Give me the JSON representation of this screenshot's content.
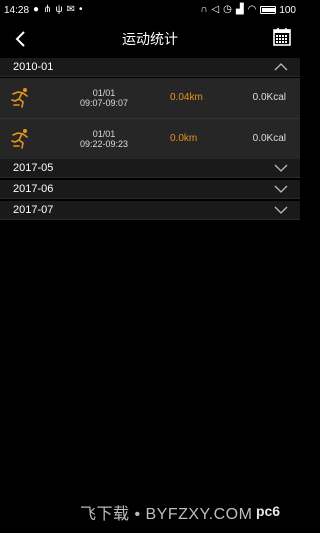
{
  "status_bar": {
    "time": "14:28",
    "battery": "100",
    "battery_level": 1.0
  },
  "header": {
    "title": "运动统计"
  },
  "months": [
    {
      "label": "2010-01",
      "expanded": true
    },
    {
      "label": "2017-05",
      "expanded": false
    },
    {
      "label": "2017-06",
      "expanded": false
    },
    {
      "label": "2017-07",
      "expanded": false
    }
  ],
  "records": [
    {
      "date": "01/01",
      "time_range": "09:07-09:07",
      "distance": "0.04km",
      "calories": "0.0Kcal",
      "icon": "runner-icon"
    },
    {
      "date": "01/01",
      "time_range": "09:22-09:23",
      "distance": "0.0km",
      "calories": "0.0Kcal",
      "icon": "runner-icon"
    }
  ],
  "watermark": {
    "text": "飞下载 • BYFZXY.COM",
    "logo": "pc6"
  },
  "colors": {
    "accent": "#e8951c",
    "background": "#000000",
    "row": "#262626"
  }
}
